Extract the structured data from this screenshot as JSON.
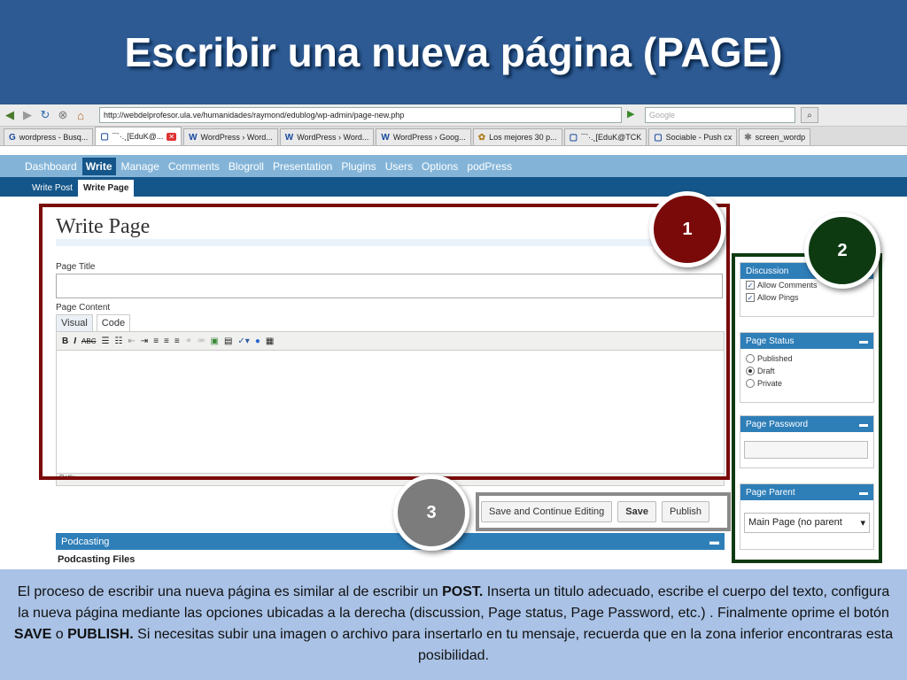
{
  "slide": {
    "title": "Escribir una nueva página (PAGE)"
  },
  "browser": {
    "url": "http://webdelprofesor.ula.ve/humanidades/raymond/edublog/wp-admin/page-new.php",
    "search_placeholder": "Google",
    "tabs": [
      {
        "label": "wordpress - Busq..."
      },
      {
        "label": "¯`·.¸[EduK@..."
      },
      {
        "label": "WordPress › Word..."
      },
      {
        "label": "WordPress › Word..."
      },
      {
        "label": "WordPress › Goog..."
      },
      {
        "label": "Los mejores 30 p..."
      },
      {
        "label": "¯`·.¸[EduK@TCK"
      },
      {
        "label": "Sociable - Push cx"
      },
      {
        "label": "screen_wordp"
      }
    ]
  },
  "wp": {
    "menu": [
      "Dashboard",
      "Write",
      "Manage",
      "Comments",
      "Blogroll",
      "Presentation",
      "Plugins",
      "Users",
      "Options",
      "podPress"
    ],
    "submenu": [
      "Write Post",
      "Write Page"
    ],
    "heading": "Write Page",
    "page_title_label": "Page Title",
    "page_content_label": "Page Content",
    "editor_tabs": [
      "Visual",
      "Code"
    ],
    "path_label": "Path:",
    "buttons": {
      "save_continue": "Save and Continue Editing",
      "save": "Save",
      "publish": "Publish"
    },
    "podcasting_header": "Podcasting",
    "podcasting_files": "Podcasting Files",
    "sidebar": {
      "discussion": {
        "title": "Discussion",
        "allow_comments": "Allow Comments",
        "allow_pings": "Allow Pings"
      },
      "page_status": {
        "title": "Page Status",
        "published": "Published",
        "draft": "Draft",
        "private": "Private"
      },
      "page_password": {
        "title": "Page Password"
      },
      "page_parent": {
        "title": "Page Parent",
        "selected": "Main Page (no parent"
      }
    }
  },
  "annotations": {
    "n1": "1",
    "n2": "2",
    "n3": "3"
  },
  "colors": {
    "n1": "#7a0a0a",
    "n2": "#0e3a12",
    "n3": "#7c7c7c"
  },
  "caption": {
    "t1": "El proceso de escribir una nueva página es similar al de escribir un ",
    "b1": "POST.",
    "t2": " Inserta un titulo adecuado, escribe el cuerpo del texto, configura la nueva página mediante las opciones ubicadas a la derecha (discussion, Page status, Page Password, etc.) . Finalmente oprime el botón ",
    "b2": "SAVE",
    "t3": " o ",
    "b3": "PUBLISH.",
    "t4": " Si necesitas subir una imagen o archivo para insertarlo en tu mensaje, recuerda que en la zona inferior encontraras esta posibilidad."
  }
}
